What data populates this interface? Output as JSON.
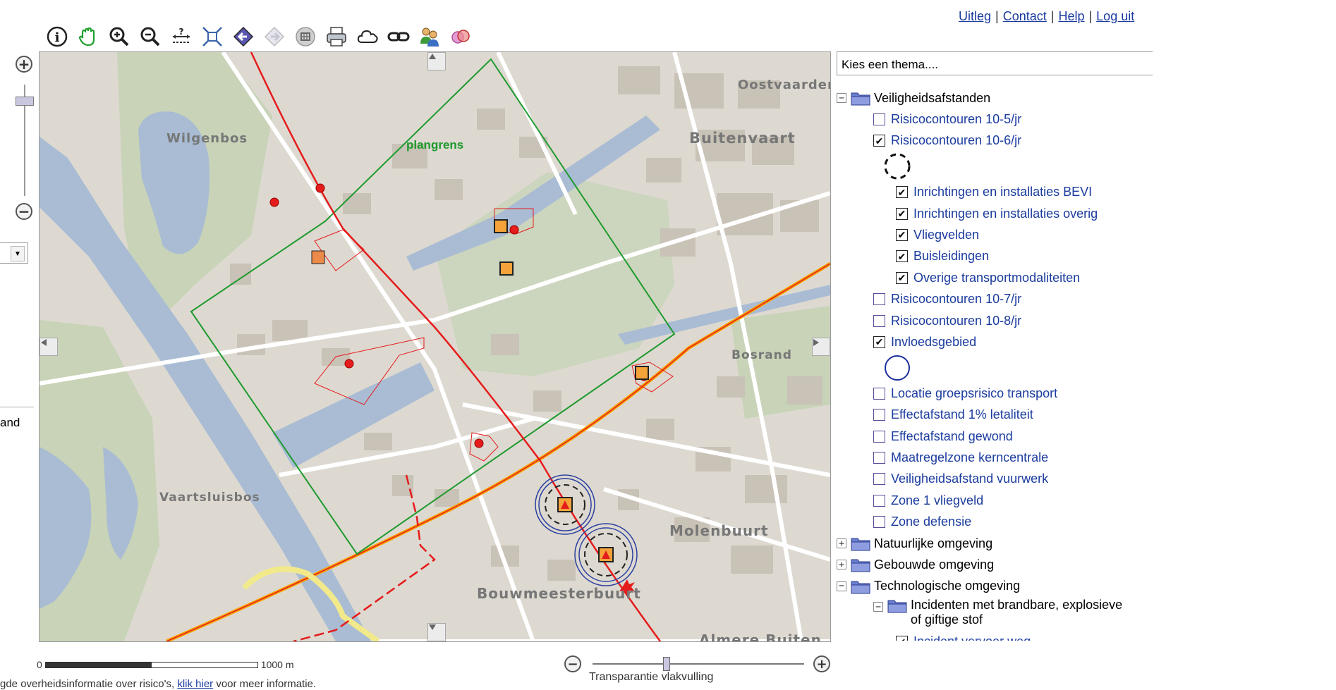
{
  "toplinks": {
    "uitleg": "Uitleg",
    "contact": "Contact",
    "help": "Help",
    "logout": "Log uit",
    "separator": "|"
  },
  "toolbar": {
    "icons": [
      "info-icon",
      "pan-hand-icon",
      "zoom-in-icon",
      "zoom-out-icon",
      "identify-icon",
      "full-extent-icon",
      "back-icon",
      "forward-icon",
      "select-area-icon",
      "print-icon",
      "cloud-icon",
      "link-icon",
      "users-icon",
      "overlap-icon"
    ]
  },
  "zoom": {
    "plus": "+",
    "minus": "−"
  },
  "leftcut": {
    "dropdown_arrow": "▼",
    "text": "and"
  },
  "map": {
    "labels": {
      "oostvaarders": "Oostvaarders",
      "wilgenbos": "Wilgenbos",
      "buitenvaart": "Buitenvaart",
      "plangrens": "plangrens",
      "bosrand": "Bosrand",
      "vaartsluisbos": "Vaartsluisbos",
      "molenbuurt": "Molenbuurt",
      "bouwmeesterbuurt": "Bouwmeesterbuurt",
      "almere_buiten": "Almere Buiten"
    },
    "colors": {
      "water": "#a9bcd4",
      "land": "#ddd9d1",
      "green": "#c8d3b8",
      "plangrens": "#1e9a2e",
      "pipeline": "#e51c1c",
      "highway": "#f7a400"
    }
  },
  "theme": {
    "select_placeholder": "Kies een thema....",
    "items": [
      {
        "type": "group",
        "expander": "−",
        "label": "Veiligheidsafstanden"
      },
      {
        "type": "item",
        "checked": false,
        "label": "Risicocontouren 10-5/jr"
      },
      {
        "type": "item",
        "checked": true,
        "label": "Risicocontouren 10-6/jr"
      },
      {
        "type": "legend-dashed-circle"
      },
      {
        "type": "subitem",
        "checked": true,
        "label": "Inrichtingen en installaties BEVI"
      },
      {
        "type": "subitem",
        "checked": true,
        "label": "Inrichtingen en installaties overig"
      },
      {
        "type": "subitem",
        "checked": true,
        "label": "Vliegvelden"
      },
      {
        "type": "subitem",
        "checked": true,
        "label": "Buisleidingen"
      },
      {
        "type": "subitem",
        "checked": true,
        "label": "Overige transportmodaliteiten"
      },
      {
        "type": "item",
        "checked": false,
        "label": "Risicocontouren 10-7/jr"
      },
      {
        "type": "item",
        "checked": false,
        "label": "Risicocontouren 10-8/jr"
      },
      {
        "type": "item",
        "checked": true,
        "label": "Invloedsgebied"
      },
      {
        "type": "legend-blue-circle"
      },
      {
        "type": "item",
        "checked": false,
        "label": "Locatie groepsrisico transport"
      },
      {
        "type": "item",
        "checked": false,
        "label": "Effectafstand 1% letaliteit"
      },
      {
        "type": "item",
        "checked": false,
        "label": "Effectafstand gewond"
      },
      {
        "type": "item",
        "checked": false,
        "label": "Maatregelzone kerncentrale"
      },
      {
        "type": "item",
        "checked": false,
        "label": "Veiligheidsafstand vuurwerk"
      },
      {
        "type": "item",
        "checked": false,
        "label": "Zone 1 vliegveld"
      },
      {
        "type": "item",
        "checked": false,
        "label": "Zone defensie"
      },
      {
        "type": "group",
        "expander": "+",
        "label": "Natuurlijke omgeving"
      },
      {
        "type": "group",
        "expander": "+",
        "label": "Gebouwde omgeving"
      },
      {
        "type": "group",
        "expander": "−",
        "label": "Technologische omgeving"
      },
      {
        "type": "subgroup",
        "expander": "−",
        "label": "Incidenten met brandbare, explosieve",
        "label2": "of giftige stof"
      },
      {
        "type": "subitem2",
        "checked": true,
        "label": "Incident vervoer weg"
      }
    ]
  },
  "scale": {
    "start": "0",
    "end": "1000 m"
  },
  "transparency": {
    "label": "Transparantie vlakvulling",
    "minus": "−",
    "plus": "+",
    "value": 0.35
  },
  "disclaimer": {
    "before": "gde overheidsinformatie over risico's, ",
    "link": "klik hier",
    "after": " voor meer informatie."
  }
}
